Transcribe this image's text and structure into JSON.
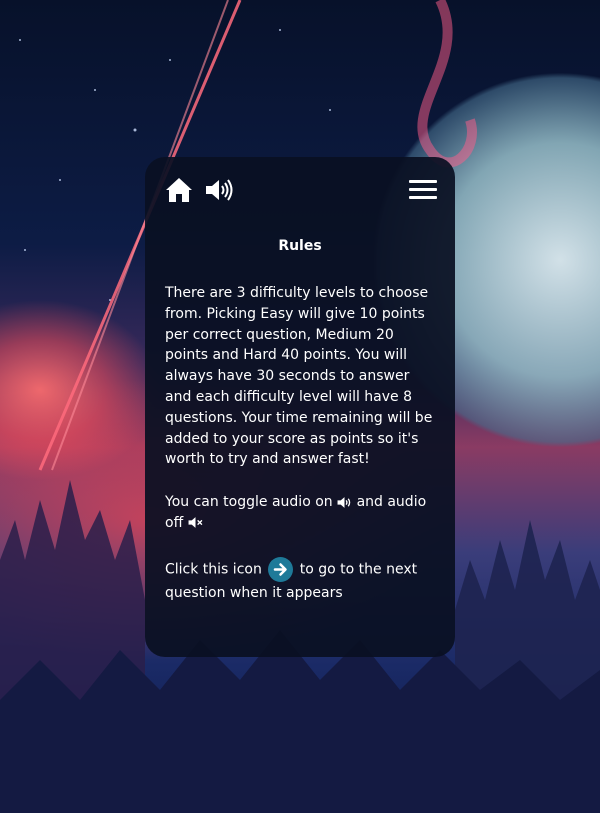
{
  "header": {
    "home_icon": "home-icon",
    "audio_icon": "speaker-on-icon",
    "menu_icon": "hamburger-menu-icon"
  },
  "rules": {
    "title": "Rules",
    "paragraph1": "There are 3 difficulty levels to choose from. Picking Easy will give 10 points per correct question, Medium 20 points and Hard 40 points. You will always have 30 seconds to answer and each difficulty level will have 8 questions. Your time remaining will be added to your score as points so it's worth to try and answer fast!",
    "audio_text_1": "You can toggle audio on",
    "audio_text_2": "and audio off",
    "next_text_1": "Click this icon",
    "next_text_2": "to go to the next question when it appears"
  },
  "colors": {
    "card_background": "#0a1022",
    "next_icon_background": "#1e7a99",
    "text": "#ffffff"
  }
}
